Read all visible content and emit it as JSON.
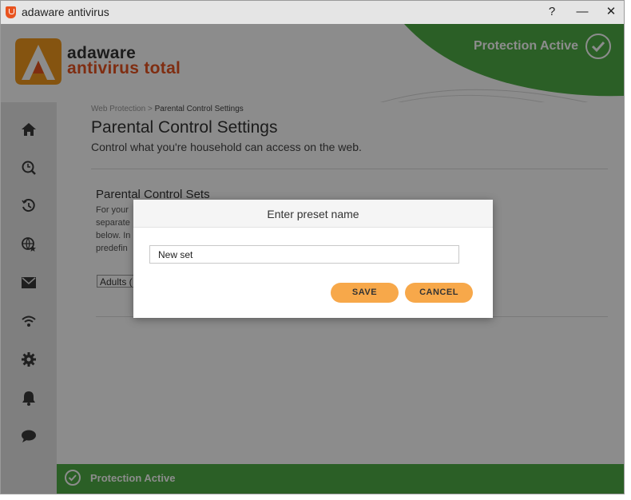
{
  "window": {
    "title": "adaware antivirus",
    "help_label": "?",
    "minimize_label": "—",
    "close_label": "✕"
  },
  "brand": {
    "name": "adaware",
    "product": "antivirus total",
    "accent_color": "#e8531f"
  },
  "header": {
    "status_text": "Protection Active",
    "status_color": "#4fae46"
  },
  "sidebar": {
    "items": [
      {
        "name": "home",
        "icon": "home-icon"
      },
      {
        "name": "scan",
        "icon": "scan-icon"
      },
      {
        "name": "history",
        "icon": "history-icon"
      },
      {
        "name": "web-protection",
        "icon": "globe-star-icon"
      },
      {
        "name": "email",
        "icon": "mail-icon"
      },
      {
        "name": "network",
        "icon": "wifi-icon"
      },
      {
        "name": "settings",
        "icon": "gear-icon"
      },
      {
        "name": "notifications",
        "icon": "bell-icon"
      },
      {
        "name": "support",
        "icon": "chat-icon"
      }
    ]
  },
  "main": {
    "breadcrumb_parent": "Web Protection",
    "breadcrumb_separator": " > ",
    "breadcrumb_current": "Parental Control Settings",
    "title": "Parental Control Settings",
    "subtitle": "Control what you're household can access on the web.",
    "section_title": "Parental Control Sets",
    "section_lines": [
      "For your",
      "separate",
      "below. In",
      "predefin"
    ],
    "preset_value": "Adults ("
  },
  "dialog": {
    "title": "Enter preset name",
    "input_value": "New set",
    "save_label": "SAVE",
    "cancel_label": "CANCEL",
    "button_color": "#f7a84a"
  },
  "footer": {
    "status_text": "Protection Active"
  }
}
